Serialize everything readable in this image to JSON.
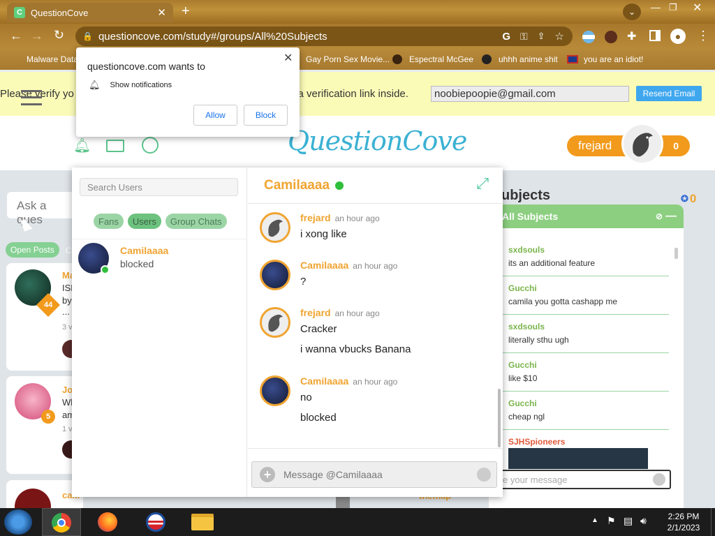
{
  "browser": {
    "tab_title": "QuestionCove",
    "url": "questioncove.com/study#/groups/All%20Subjects",
    "bookmarks": [
      "Malware Data",
      "Gay Porn Sex Movie...",
      "Espectral McGee",
      "uhhh anime shit",
      "you are an idiot!"
    ]
  },
  "notification_prompt": {
    "title": "questioncove.com wants to",
    "permission": "Show notifications",
    "allow": "Allow",
    "block": "Block"
  },
  "verify_bar": {
    "text_start": "Please verify yo",
    "text_end": "n a verification link inside.",
    "email": "noobiepoopie@gmail.com",
    "resend": "Resend Email"
  },
  "header": {
    "logo": "QuestionCove",
    "username": "frejard",
    "points": "0"
  },
  "left_feed": {
    "search_placeholder": "Ask a ques",
    "tab_open": "Open Posts",
    "tab_closed": "Cl",
    "posts": [
      {
        "name": "Ma",
        "text": "ISH",
        "text2": "by",
        "text3": "...",
        "badge": "44",
        "views": "3 v"
      },
      {
        "name": "Jos",
        "text": "Wh",
        "text2": "am",
        "badge": "5",
        "views": "1 v"
      },
      {
        "name": "ca..."
      }
    ]
  },
  "chat": {
    "search_placeholder": "Search Users",
    "tabs": [
      "Fans",
      "Users",
      "Group Chats"
    ],
    "contacts": [
      {
        "name": "Camilaaaa",
        "status": "blocked"
      }
    ],
    "active_contact": "Camilaaaa",
    "messages": [
      {
        "name": "frejard",
        "time": "an hour ago",
        "lines": [
          "i xong like"
        ],
        "avatar": "dolphin"
      },
      {
        "name": "Camilaaaa",
        "time": "an hour ago",
        "lines": [
          "?"
        ],
        "avatar": "photo"
      },
      {
        "name": "frejard",
        "time": "an hour ago",
        "lines": [
          "Cracker",
          "i wanna vbucks Banana"
        ],
        "avatar": "dolphin"
      },
      {
        "name": "Camilaaaa",
        "time": "an hour ago",
        "lines": [
          "no",
          "blocked"
        ],
        "avatar": "photo"
      }
    ],
    "input_placeholder": "Message @Camilaaaa"
  },
  "group_panel": {
    "title_partial": "ubjects",
    "points": "0",
    "group_name": "All Subjects",
    "messages": [
      {
        "name": "sxdsouls",
        "text": "its an additional feature"
      },
      {
        "name": "Gucchi",
        "text": "camila you gotta cashapp me"
      },
      {
        "name": "sxdsouls",
        "text": "literally sthu ugh"
      },
      {
        "name": "Gucchi",
        "text": "like $10"
      },
      {
        "name": "Gucchi",
        "text": "cheap ngl"
      },
      {
        "name": "SJHSpioneers",
        "text": ""
      }
    ],
    "input_placeholder": "e your message",
    "bottom_user": "themap"
  },
  "taskbar": {
    "time": "2:26 PM",
    "date": "2/1/2023"
  }
}
